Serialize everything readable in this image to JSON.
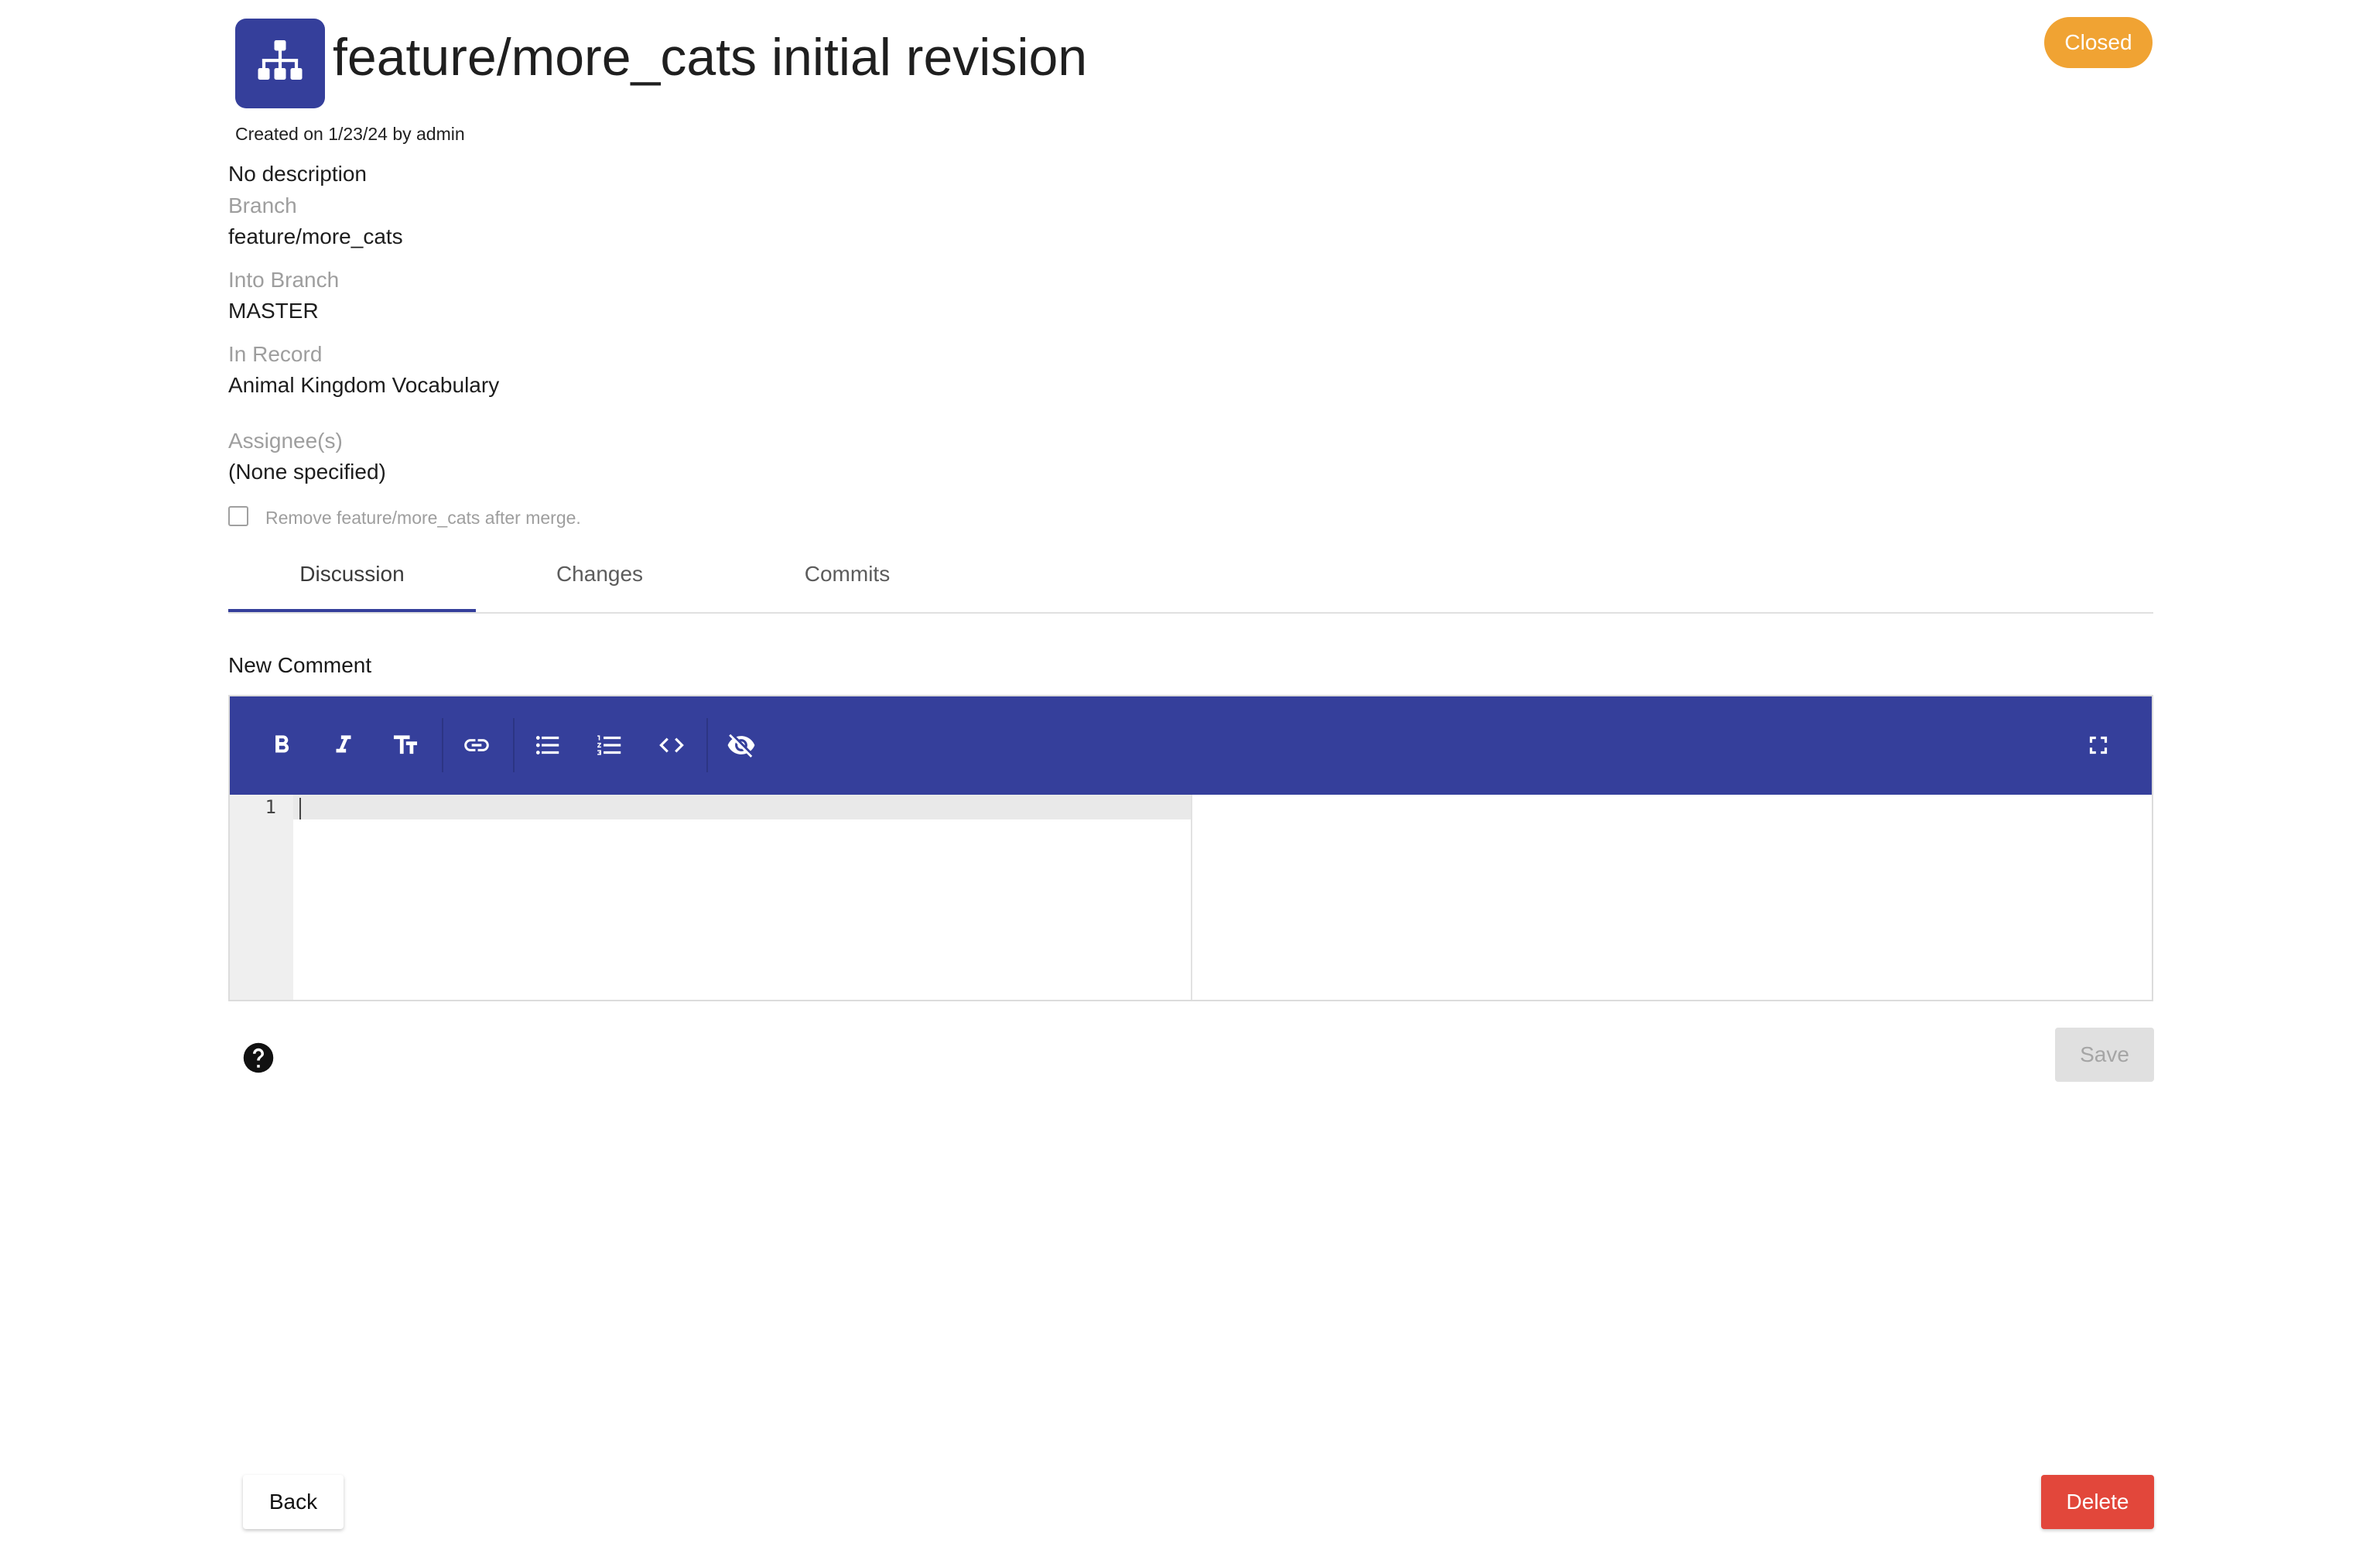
{
  "header": {
    "icon": "sitemap-icon",
    "title": "feature/more_cats initial revision",
    "created_line": "Created on 1/23/24 by admin",
    "status": "Closed"
  },
  "meta": {
    "description": "No description",
    "branch_label": "Branch",
    "branch_value": "feature/more_cats",
    "into_branch_label": "Into Branch",
    "into_branch_value": "MASTER",
    "record_label": "In Record",
    "record_value": "Animal Kingdom Vocabulary",
    "assignees_label": "Assignee(s)",
    "assignees_value": "(None specified)",
    "remove_branch_label": "Remove feature/more_cats after merge.",
    "remove_branch_checked": false
  },
  "tabs": [
    {
      "label": "Discussion",
      "active": true
    },
    {
      "label": "Changes",
      "active": false
    },
    {
      "label": "Commits",
      "active": false
    }
  ],
  "comment": {
    "heading": "New Comment",
    "line_number": "1",
    "toolbar": [
      "bold-icon",
      "italic-icon",
      "heading-icon",
      "link-icon",
      "bulleted-list-icon",
      "numbered-list-icon",
      "code-icon",
      "toggle-preview-icon",
      "fullscreen-icon"
    ],
    "save_label": "Save"
  },
  "footer": {
    "back_label": "Back",
    "delete_label": "Delete"
  },
  "colors": {
    "primary": "#353f9b",
    "status_closed": "#f0a333",
    "danger": "#e2473b"
  }
}
